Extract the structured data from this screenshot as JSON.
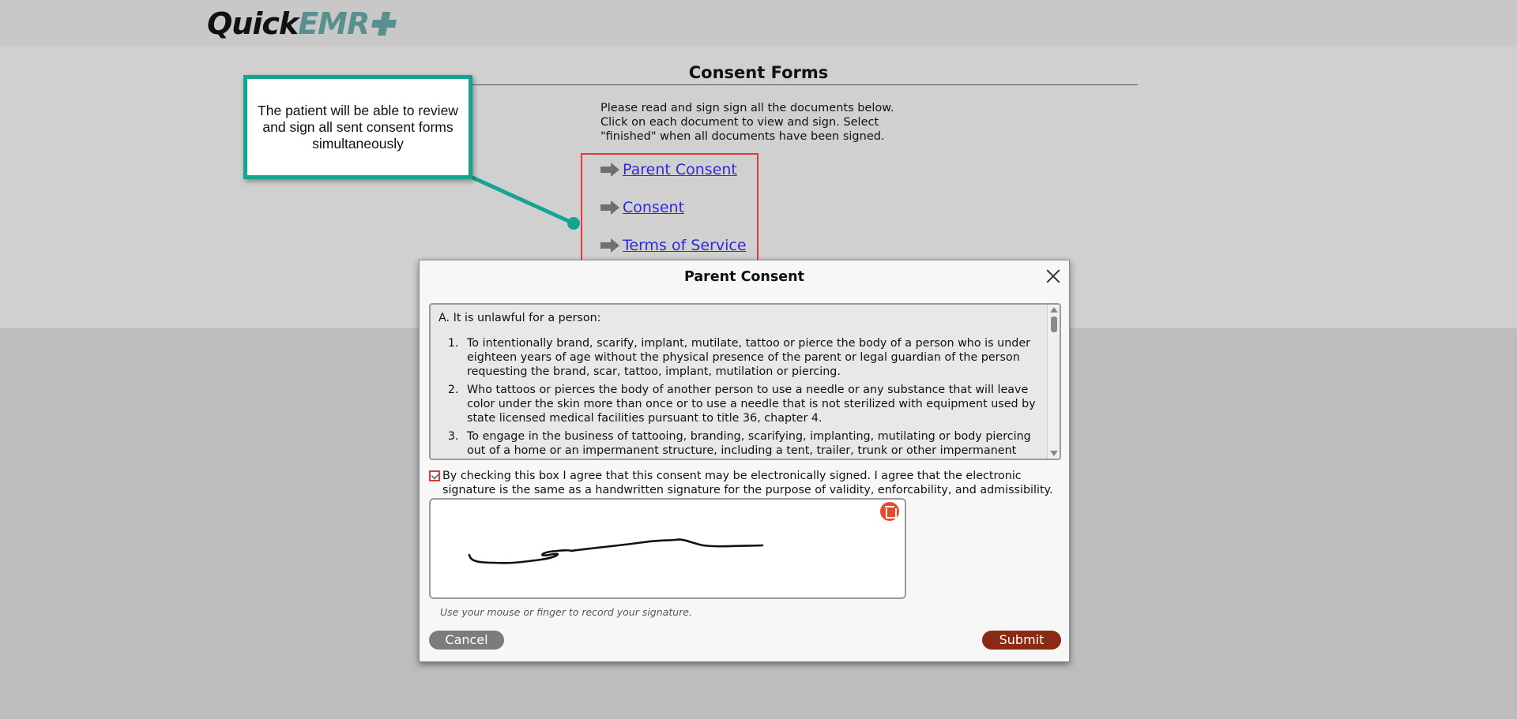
{
  "header": {
    "logo_quick": "Quick",
    "logo_emr": "EMR"
  },
  "page": {
    "title": "Consent Forms",
    "intro": "Please read and sign sign all the documents below. Click on each document to view and sign. Select \"finished\" when all documents have been signed.",
    "documents": [
      "Parent Consent",
      "Consent",
      "Terms of Service"
    ]
  },
  "callout": {
    "text": "The patient will be able to review and sign all sent consent forms simultaneously"
  },
  "modal": {
    "title": "Parent Consent",
    "doc_intro": "A. It is unlawful for a person:",
    "doc_items": [
      "To intentionally brand, scarify, implant, mutilate, tattoo or pierce the body of a person who is under eighteen years of age without the physical presence of the parent or legal guardian of the person requesting the brand, scar, tattoo, implant, mutilation or piercing.",
      "Who tattoos or pierces the body of another person to use a needle or any substance that will leave color under the skin more than once or to use a needle that is not sterilized with equipment used by state licensed medical facilities pursuant to title 36, chapter 4.",
      "To engage in the business of tattooing, branding, scarifying, implanting, mutilating or body piercing out of a home or an impermanent structure, including a tent, trailer, trunk or other impermanent structure."
    ],
    "agree_text": "By checking this box I agree that this consent may be electronically signed. I agree that the electronic signature is the same as a handwritten signature for the purpose of validity, enforcability, and admissibility.",
    "agree_checked": true,
    "signature_hint": "Use your mouse or finger to record your signature.",
    "cancel_label": "Cancel",
    "submit_label": "Submit"
  },
  "colors": {
    "brand_teal": "#5a8f8f",
    "callout_border": "#13a58f",
    "highlight_red": "#e0393e",
    "submit_bg": "#8a2a14",
    "cancel_bg": "#7c7c7c",
    "link_blue": "#2b2bd8"
  },
  "icons": {
    "link_arrow": "arrow-right-icon",
    "close": "close-icon",
    "clear_signature": "trash-icon",
    "checkbox": "checkbox-icon",
    "logo_mark": "plus-icon"
  }
}
